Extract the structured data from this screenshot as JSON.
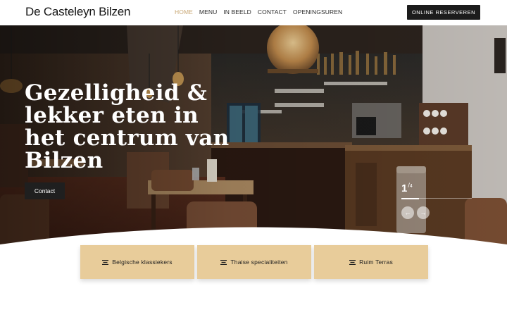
{
  "header": {
    "logo": "De Casteleyn Bilzen",
    "nav": [
      {
        "label": "HOME",
        "active": true
      },
      {
        "label": "MENU",
        "active": false
      },
      {
        "label": "IN BEELD",
        "active": false
      },
      {
        "label": "CONTACT",
        "active": false
      },
      {
        "label": "OPENINGSUREN",
        "active": false
      }
    ],
    "cta_label": "ONLINE RESERVEREN"
  },
  "hero": {
    "headline": "Gezelligheid & lekker eten in het centrum van Bilzen",
    "contact_label": "Contact",
    "slider": {
      "current": "1",
      "separator": "/",
      "total": "4",
      "progress": 0.25
    },
    "prev_icon": "arrow-left-icon",
    "next_icon": "arrow-right-icon"
  },
  "features": [
    {
      "label": "Belgische klassiekers",
      "icon": "lines-icon"
    },
    {
      "label": "Thaise specialiteiten",
      "icon": "lines-icon"
    },
    {
      "label": "Ruim Terras",
      "icon": "lines-icon"
    }
  ],
  "colors": {
    "accent": "#c9a876",
    "card": "#e8cc9a",
    "dark": "#1c1c1c"
  }
}
